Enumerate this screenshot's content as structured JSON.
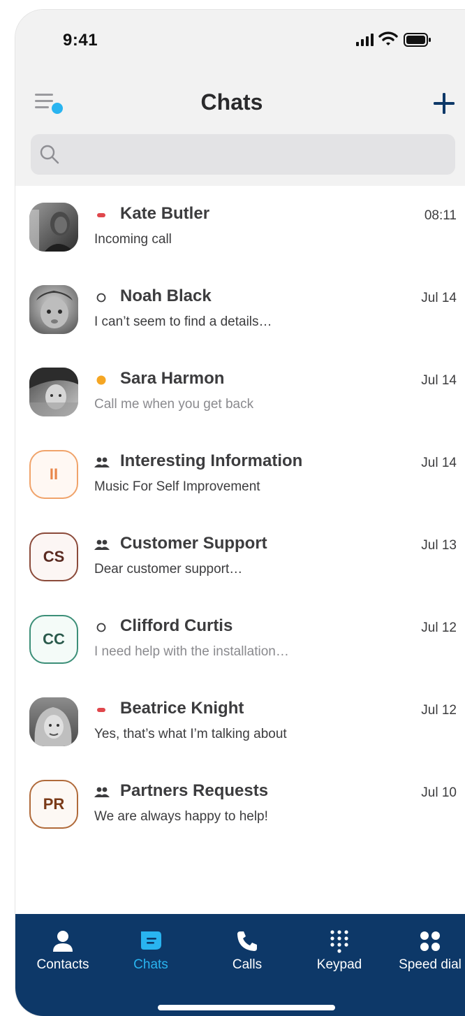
{
  "status_bar": {
    "time": "9:41"
  },
  "header": {
    "title": "Chats"
  },
  "search": {
    "placeholder": ""
  },
  "chats": [
    {
      "name": "Kate Butler",
      "preview": "Incoming call",
      "time": "08:11",
      "status": "busy"
    },
    {
      "name": "Noah Black",
      "preview": "I can’t seem to find a details…",
      "time": "Jul 14",
      "status": "offline"
    },
    {
      "name": "Sara Harmon",
      "preview": "Call me when you get back",
      "time": "Jul 14",
      "status": "away"
    },
    {
      "name": "Interesting Information",
      "preview": "Music For Self Improvement",
      "time": "Jul 14",
      "status": "group",
      "initials": "II"
    },
    {
      "name": "Customer Support",
      "preview": "Dear customer support…",
      "time": "Jul 13",
      "status": "group",
      "initials": "CS"
    },
    {
      "name": "Clifford Curtis",
      "preview": "I need help with the installation…",
      "time": "Jul 12",
      "status": "offline",
      "initials": "CC"
    },
    {
      "name": "Beatrice Knight",
      "preview": "Yes, that’s what I’m talking about",
      "time": "Jul 12",
      "status": "busy"
    },
    {
      "name": "Partners Requests",
      "preview": "We are always happy to help!",
      "time": "Jul 10",
      "status": "group",
      "initials": "PR"
    }
  ],
  "tabbar": {
    "items": [
      {
        "label": "Contacts",
        "icon": "person-icon",
        "active": false
      },
      {
        "label": "Chats",
        "icon": "chat-bubble-icon",
        "active": true
      },
      {
        "label": "Calls",
        "icon": "phone-icon",
        "active": false
      },
      {
        "label": "Keypad",
        "icon": "keypad-icon",
        "active": false
      },
      {
        "label": "Speed dial",
        "icon": "speed-dial-icon",
        "active": false
      }
    ]
  },
  "colors": {
    "accent": "#29b4f0",
    "tabbar_bg": "#0d3868",
    "busy": "#e0474c",
    "away": "#f5a623",
    "ii_border": "#f0a36a",
    "cs_border": "#8b4a3a",
    "cc_border": "#3c8f78",
    "pr_border": "#b06a3a"
  }
}
